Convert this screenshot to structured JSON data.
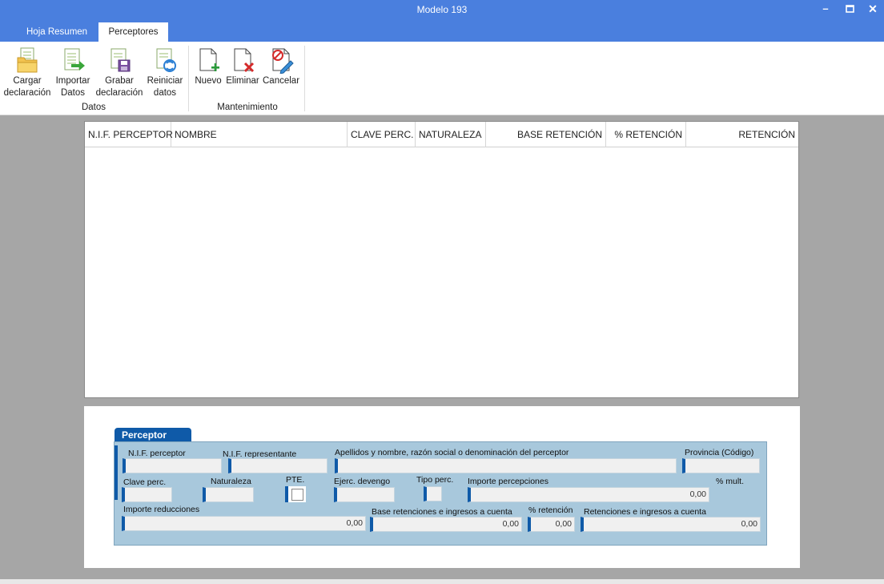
{
  "window": {
    "title": "Modelo 193"
  },
  "tabs": [
    {
      "label": "Hoja Resumen"
    },
    {
      "label": "Perceptores"
    }
  ],
  "ribbon": {
    "datos": {
      "group_label": "Datos",
      "buttons": [
        {
          "line1": "Cargar",
          "line2": "declaración"
        },
        {
          "line1": "Importar",
          "line2": "Datos"
        },
        {
          "line1": "Grabar",
          "line2": "declaración"
        },
        {
          "line1": "Reiniciar",
          "line2": "datos"
        }
      ]
    },
    "mantenimiento": {
      "group_label": "Mantenimiento",
      "buttons": [
        {
          "label": "Nuevo"
        },
        {
          "label": "Eliminar"
        },
        {
          "label": "Cancelar"
        }
      ]
    }
  },
  "grid": {
    "columns": [
      "N.I.F. PERCEPTOR",
      "NOMBRE",
      "CLAVE PERC.",
      "NATURALEZA",
      "BASE RETENCIÓN",
      "% RETENCIÓN",
      "RETENCIÓN"
    ]
  },
  "form": {
    "section_title": "Perceptor",
    "labels": {
      "nif_perceptor": "N.I.F. perceptor",
      "nif_representante": "N.I.F. representante",
      "apellidos": "Apellidos y nombre, razón social o denominación del perceptor",
      "provincia": "Provincia (Código)",
      "clave": "Clave perc.",
      "naturaleza": "Naturaleza",
      "pte": "PTE.",
      "ejercicio": "Ejerc. devengo",
      "tipo": "Tipo perc.",
      "importe_percepciones": "Importe percepciones",
      "pct_mult": "% mult.",
      "importe_reducciones": "Importe reducciones",
      "base_retenciones": "Base retenciones e ingresos a cuenta",
      "pct_retencion": "% retención",
      "retenciones": "Retenciones e ingresos a cuenta"
    },
    "values": {
      "importe_percepciones": "0,00",
      "importe_reducciones": "0,00",
      "base_retenciones": "0,00",
      "pct_retencion": "0,00",
      "retenciones": "0,00"
    }
  }
}
